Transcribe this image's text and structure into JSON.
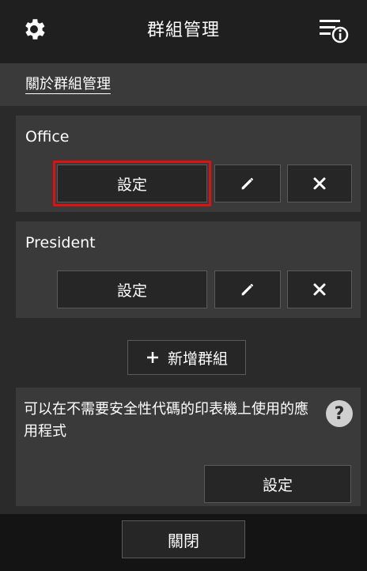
{
  "header": {
    "title": "群組管理",
    "left_icon": "gear-icon",
    "right_icon": "info-list-icon"
  },
  "about_link": "關於群組管理",
  "groups": [
    {
      "name": "Office",
      "settings_label": "設定",
      "edit_icon": "pencil-icon",
      "delete_icon": "close-icon"
    },
    {
      "name": "President",
      "settings_label": "設定",
      "edit_icon": "pencil-icon",
      "delete_icon": "close-icon"
    }
  ],
  "add_group": {
    "label": "新增群組",
    "icon": "plus-icon"
  },
  "apps_section": {
    "description": "可以在不需要安全性代碼的印表機上使用的應用程式",
    "help_icon": "question-icon",
    "settings_label": "設定"
  },
  "footer": {
    "close_label": "關閉"
  },
  "colors": {
    "highlight": "#e01010",
    "panel": "#3a3a3a",
    "background": "#2a2a2a"
  }
}
